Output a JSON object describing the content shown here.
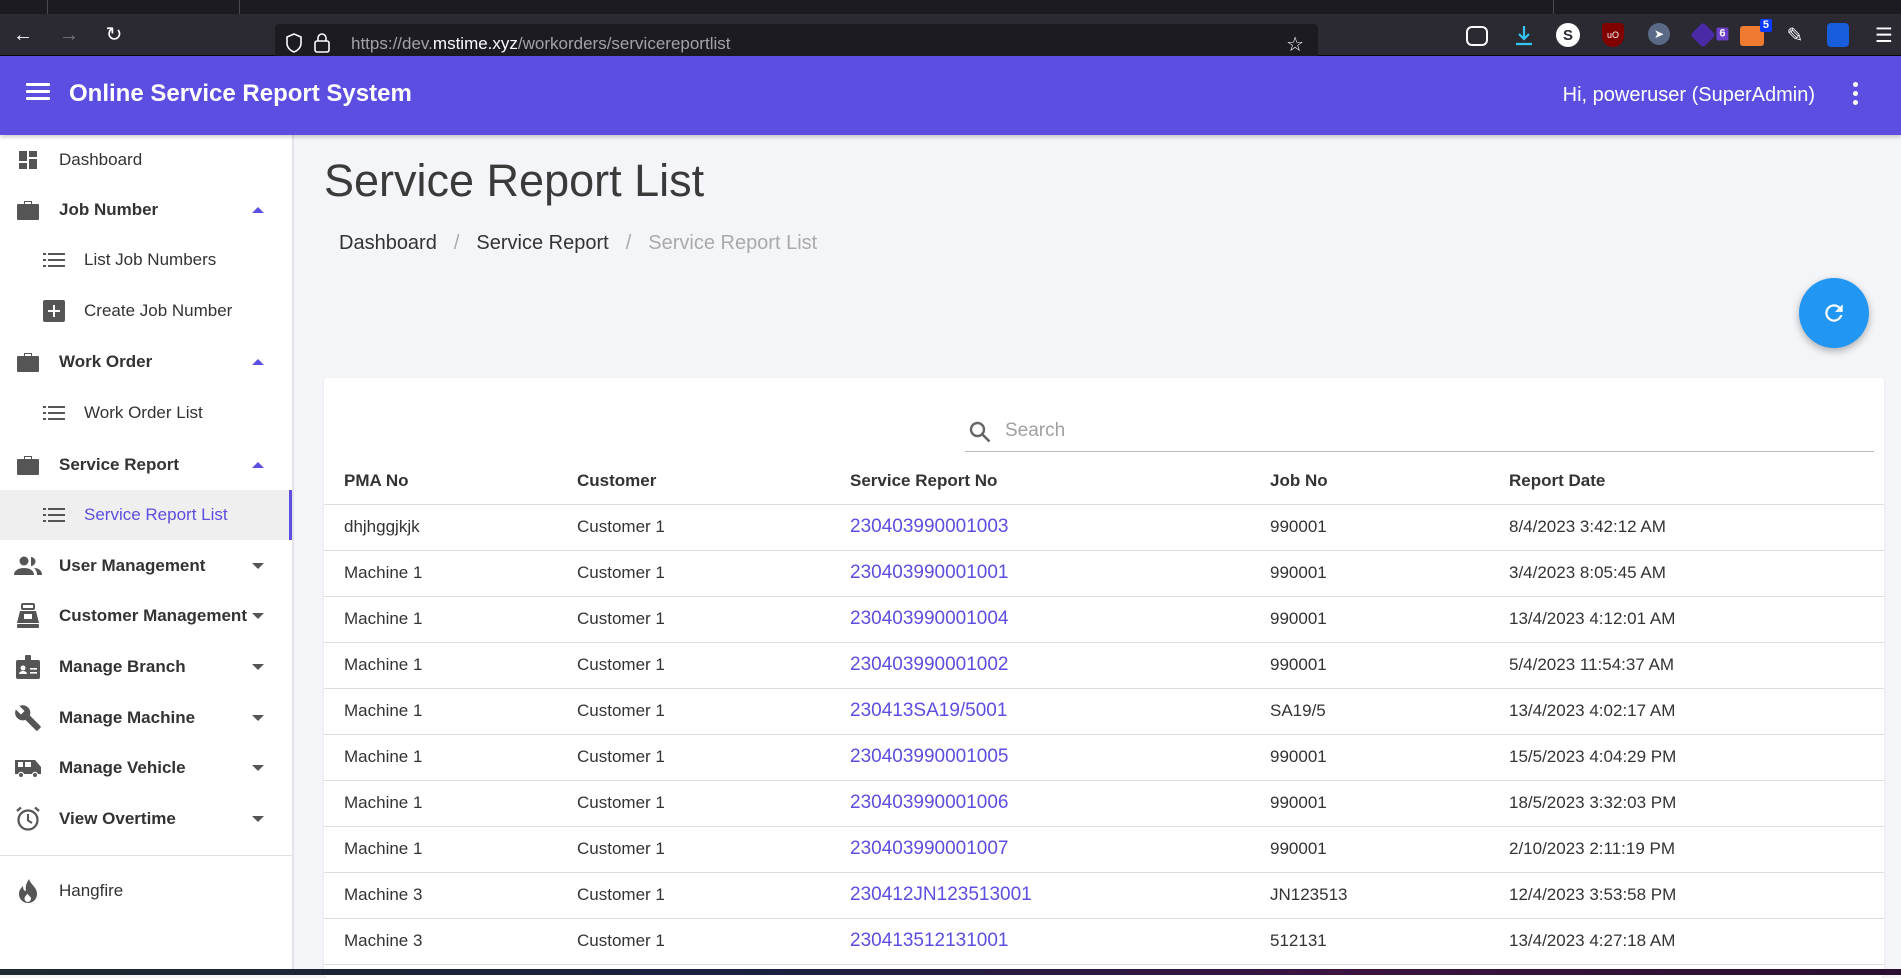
{
  "browser": {
    "url_prefix": "https://dev.",
    "url_domain": "mstime.xyz",
    "url_path": "/workorders/servicereportlist",
    "extension_badges": {
      "ext6": "6",
      "ext5": "5"
    }
  },
  "header": {
    "title": "Online Service Report System",
    "user": "Hi, poweruser (SuperAdmin)"
  },
  "sidebar": {
    "items": [
      {
        "label": "Dashboard"
      },
      {
        "label": "Job Number"
      },
      {
        "label": "List Job Numbers"
      },
      {
        "label": "Create Job Number"
      },
      {
        "label": "Work Order"
      },
      {
        "label": "Work Order List"
      },
      {
        "label": "Service Report"
      },
      {
        "label": "Service Report List"
      },
      {
        "label": "User Management"
      },
      {
        "label": "Customer Management"
      },
      {
        "label": "Manage Branch"
      },
      {
        "label": "Manage Machine"
      },
      {
        "label": "Manage Vehicle"
      },
      {
        "label": "View Overtime"
      },
      {
        "label": "Hangfire"
      }
    ]
  },
  "main": {
    "title": "Service Report List",
    "breadcrumb": [
      "Dashboard",
      "Service Report",
      "Service Report List"
    ],
    "search_placeholder": "Search",
    "search_value": "",
    "columns": [
      "PMA No",
      "Customer",
      "Service Report No",
      "Job No",
      "Report Date"
    ],
    "rows": [
      {
        "pma": "dhjhggjkjk",
        "customer": "Customer 1",
        "report_no": "230403990001003",
        "job_no": "990001",
        "date": "8/4/2023 3:42:12 AM"
      },
      {
        "pma": "Machine 1",
        "customer": "Customer 1",
        "report_no": "230403990001001",
        "job_no": "990001",
        "date": "3/4/2023 8:05:45 AM"
      },
      {
        "pma": "Machine 1",
        "customer": "Customer 1",
        "report_no": "230403990001004",
        "job_no": "990001",
        "date": "13/4/2023 4:12:01 AM"
      },
      {
        "pma": "Machine 1",
        "customer": "Customer 1",
        "report_no": "230403990001002",
        "job_no": "990001",
        "date": "5/4/2023 11:54:37 AM"
      },
      {
        "pma": "Machine 1",
        "customer": "Customer 1",
        "report_no": "230413SA19/5001",
        "job_no": "SA19/5",
        "date": "13/4/2023 4:02:17 AM"
      },
      {
        "pma": "Machine 1",
        "customer": "Customer 1",
        "report_no": "230403990001005",
        "job_no": "990001",
        "date": "15/5/2023 4:04:29 PM"
      },
      {
        "pma": "Machine 1",
        "customer": "Customer 1",
        "report_no": "230403990001006",
        "job_no": "990001",
        "date": "18/5/2023 3:32:03 PM"
      },
      {
        "pma": "Machine 1",
        "customer": "Customer 1",
        "report_no": "230403990001007",
        "job_no": "990001",
        "date": "2/10/2023 2:11:19 PM"
      },
      {
        "pma": "Machine 3",
        "customer": "Customer 1",
        "report_no": "230412JN123513001",
        "job_no": "JN123513",
        "date": "12/4/2023 3:53:58 PM"
      },
      {
        "pma": "Machine 3",
        "customer": "Customer 1",
        "report_no": "230413512131001",
        "job_no": "512131",
        "date": "13/4/2023 4:27:18 AM"
      }
    ]
  },
  "colors": {
    "primary": "#5c4ee0",
    "fab": "#2196f3",
    "link": "#5c4ee0"
  }
}
